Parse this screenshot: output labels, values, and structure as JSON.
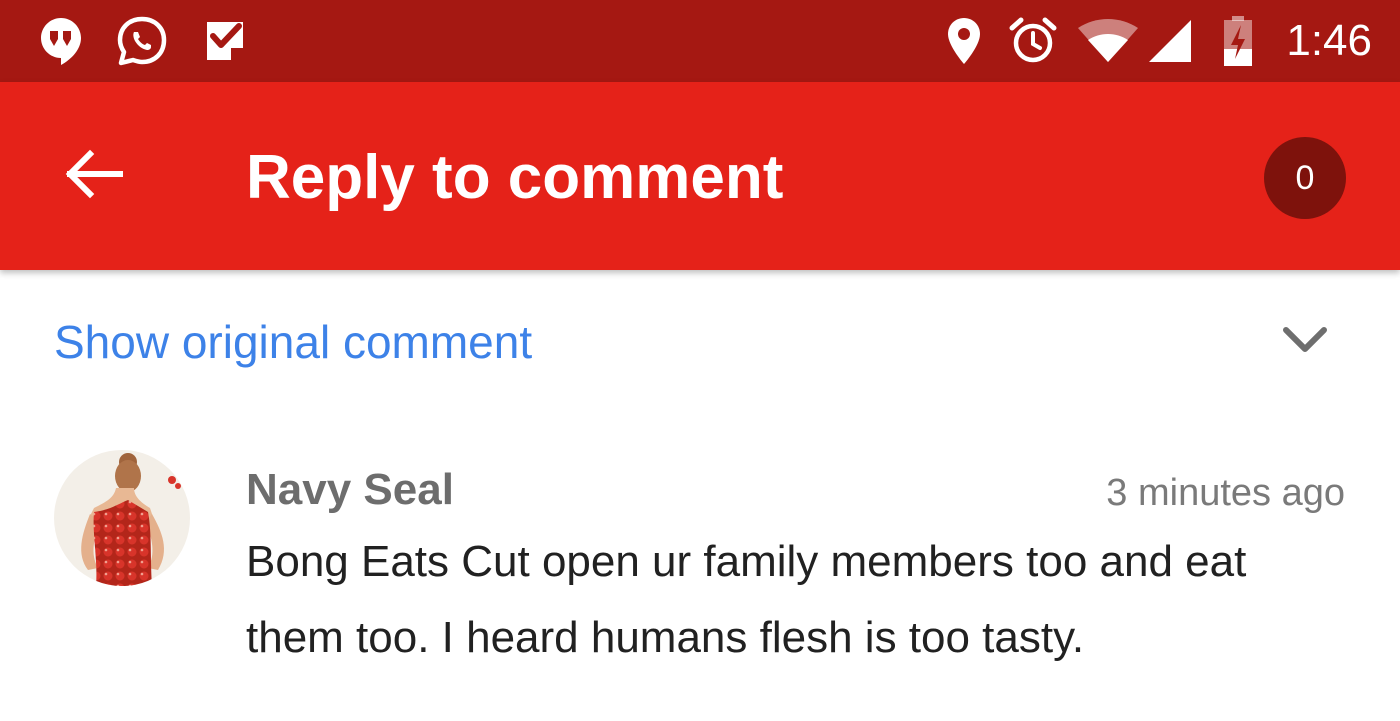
{
  "status_bar": {
    "time": "1:46",
    "left_icons": [
      "hangouts-icon",
      "whatsapp-icon",
      "check-app-icon"
    ],
    "right_icons": [
      "location-icon",
      "alarm-icon",
      "wifi-icon",
      "signal-icon",
      "battery-charging-icon"
    ]
  },
  "app_bar": {
    "title": "Reply to comment",
    "count": "0",
    "background_color": "#e52219",
    "status_color": "#a51812"
  },
  "show_original": {
    "label": "Show original comment",
    "link_color": "#3d82e8"
  },
  "comment": {
    "author": "Navy Seal",
    "timestamp": "3 minutes ago",
    "text": "Bong Eats Cut open ur family members too and eat them too. I heard humans flesh is too tasty."
  }
}
